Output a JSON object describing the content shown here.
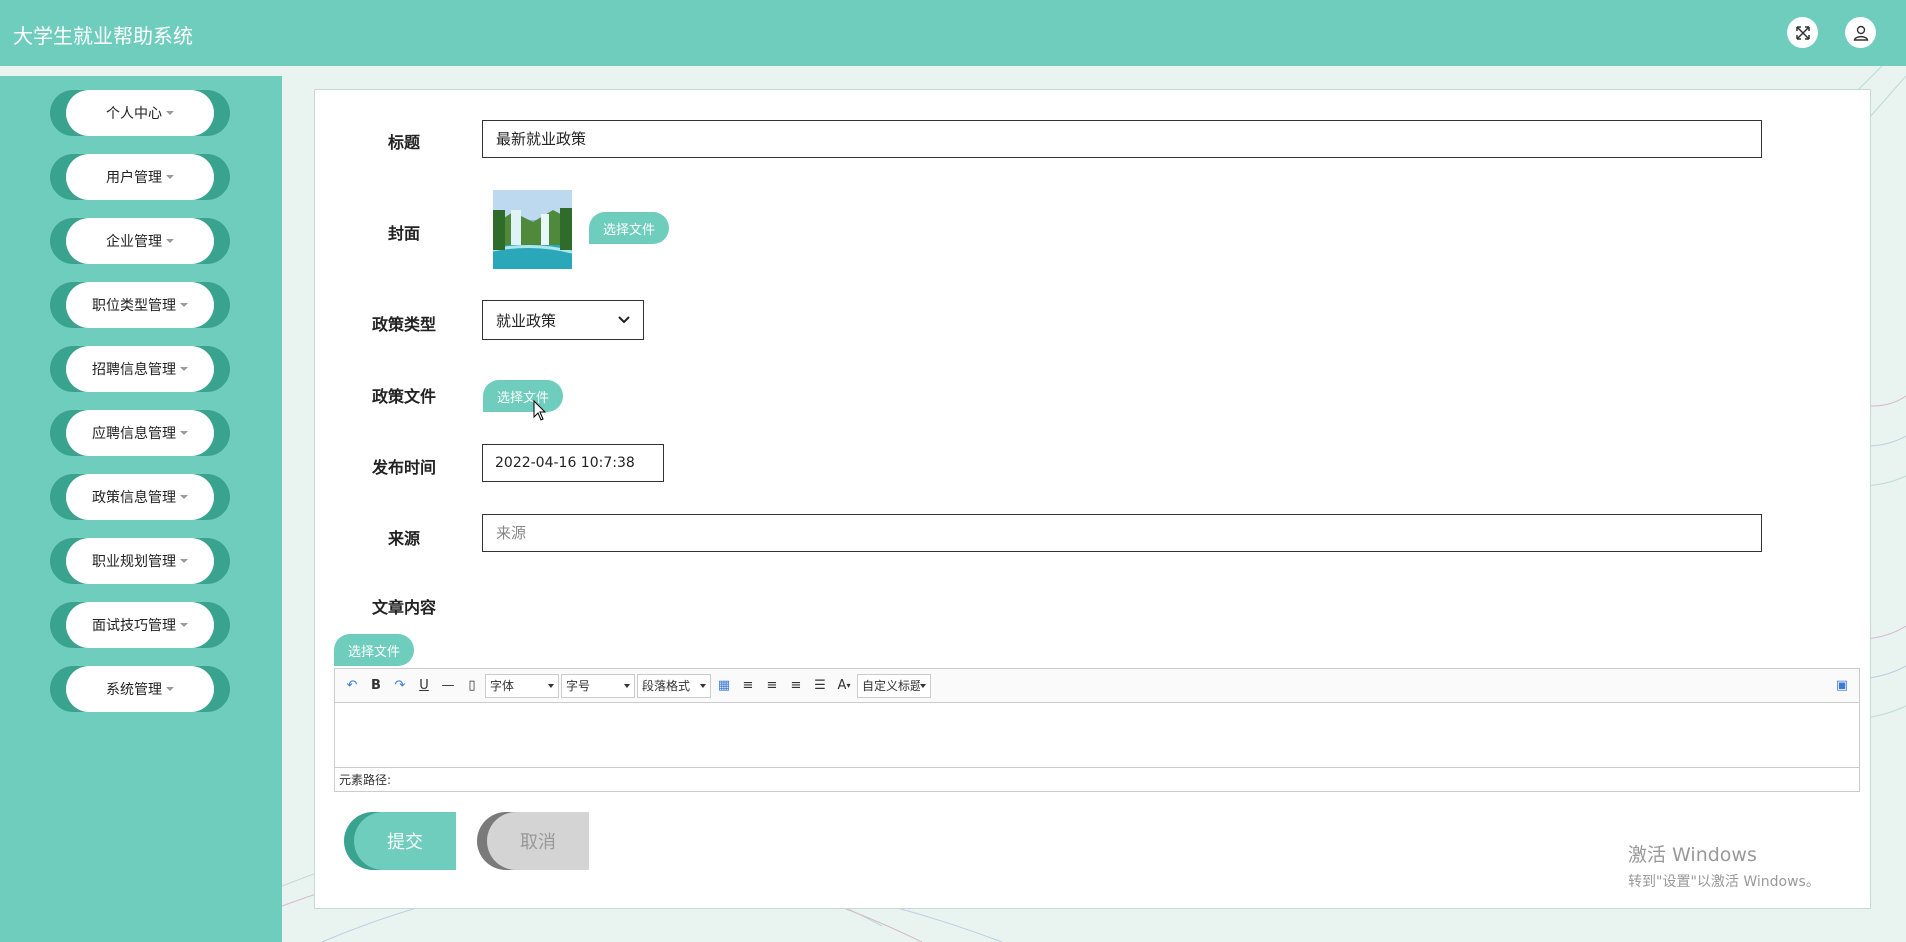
{
  "app": {
    "title": "大学生就业帮助系统"
  },
  "header": {
    "icons": [
      "fullscreen-icon",
      "user-icon"
    ]
  },
  "sidebar": {
    "items": [
      {
        "label": "个人中心"
      },
      {
        "label": "用户管理"
      },
      {
        "label": "企业管理"
      },
      {
        "label": "职位类型管理"
      },
      {
        "label": "招聘信息管理"
      },
      {
        "label": "应聘信息管理"
      },
      {
        "label": "政策信息管理"
      },
      {
        "label": "职业规划管理"
      },
      {
        "label": "面试技巧管理"
      },
      {
        "label": "系统管理"
      }
    ]
  },
  "form": {
    "title": {
      "label": "标题",
      "value": "最新就业政策"
    },
    "cover": {
      "label": "封面",
      "button": "选择文件"
    },
    "policy_type": {
      "label": "政策类型",
      "value": "就业政策"
    },
    "policy_file": {
      "label": "政策文件",
      "button": "选择文件"
    },
    "publish_time": {
      "label": "发布时间",
      "value": "2022-04-16 10:7:38"
    },
    "source": {
      "label": "来源",
      "placeholder": "来源",
      "value": ""
    },
    "content": {
      "label": "文章内容",
      "button": "选择文件"
    }
  },
  "editor": {
    "font_label": "字体",
    "size_label": "字号",
    "paragraph_label": "段落格式",
    "custom_title_label": "自定义标题",
    "element_path_label": "元素路径:"
  },
  "actions": {
    "submit_label": "提交",
    "cancel_label": "取消"
  },
  "watermark": {
    "line1": "激活 Windows",
    "line2": "转到\"设置\"以激活 Windows。"
  },
  "colors": {
    "primary": "#6fcdbe",
    "primary_dark": "#3aa38f"
  }
}
